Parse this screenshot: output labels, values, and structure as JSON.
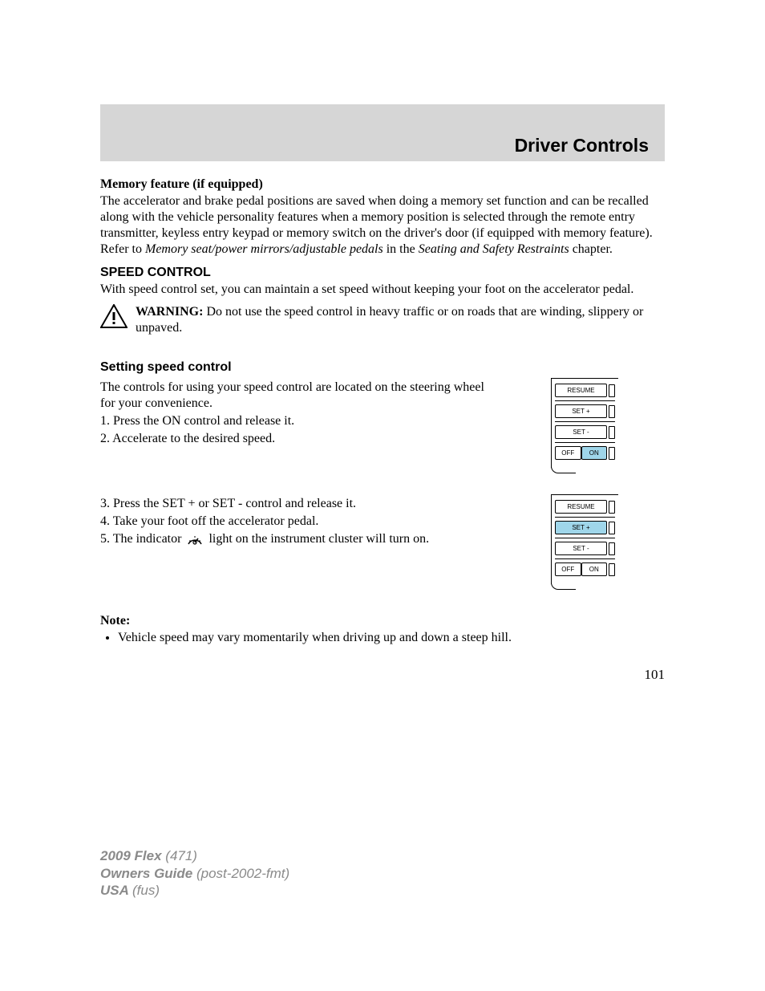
{
  "header": {
    "title": "Driver Controls"
  },
  "memory": {
    "heading": "Memory feature (if equipped)",
    "p1a": "The accelerator and brake pedal positions are saved when doing a memory set function and can be recalled along with the vehicle personality features when a memory position is selected through the remote entry transmitter, keyless entry keypad or memory switch on the driver's door (if equipped with memory feature). Refer to ",
    "p1b": "Memory seat/power mirrors/adjustable pedals",
    "p1c": " in the ",
    "p1d": "Seating and Safety Restraints",
    "p1e": " chapter."
  },
  "speed": {
    "heading": "SPEED CONTROL",
    "intro": "With speed control set, you can maintain a set speed without keeping your foot on the accelerator pedal.",
    "warning_label": "WARNING:",
    "warning_text": " Do not use the speed control in heavy traffic or on roads that are winding, slippery or unpaved."
  },
  "setting": {
    "heading": "Setting speed control",
    "blockA": {
      "p1": "The controls for using your speed control are located on the steering wheel for your convenience.",
      "p2": "1. Press the ON control and release it.",
      "p3": "2. Accelerate to the desired speed."
    },
    "blockB": {
      "p1": "3. Press the SET + or SET - control and release it.",
      "p2": "4. Take your foot off the accelerator pedal.",
      "p3a": "5. The indicator ",
      "p3b": " light on the instrument cluster will turn on."
    }
  },
  "note": {
    "heading": "Note:",
    "item1": "Vehicle speed may vary momentarily when driving up and down a steep hill."
  },
  "panel": {
    "resume": "RESUME",
    "setp": "SET +",
    "setm": "SET -",
    "off": "OFF",
    "on": "ON"
  },
  "page_number": "101",
  "footer": {
    "l1a": "2009 Flex ",
    "l1b": "(471)",
    "l2a": "Owners Guide ",
    "l2b": "(post-2002-fmt)",
    "l3a": "USA ",
    "l3b": "(fus)"
  }
}
